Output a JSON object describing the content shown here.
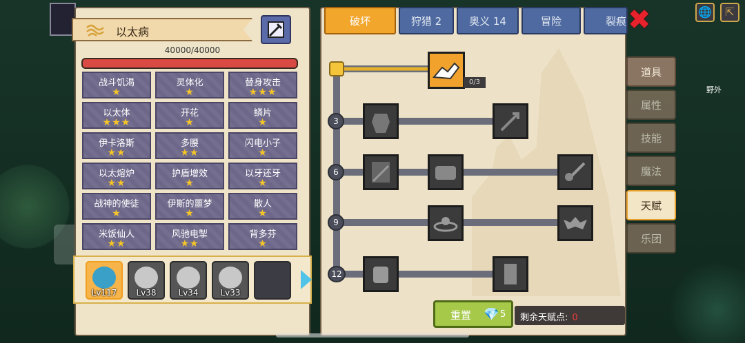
{
  "header": {
    "title": "以太病",
    "hp": "40000/40000",
    "hp_fraction": 1.0
  },
  "traits": [
    {
      "name": "战斗饥渴",
      "stars": 1
    },
    {
      "name": "灵体化",
      "stars": 1
    },
    {
      "name": "替身攻击",
      "stars": 3
    },
    {
      "name": "以太体",
      "stars": 3
    },
    {
      "name": "开花",
      "stars": 1
    },
    {
      "name": "鳞片",
      "stars": 1
    },
    {
      "name": "伊卡洛斯",
      "stars": 2
    },
    {
      "name": "多腰",
      "stars": 2
    },
    {
      "name": "闪电小子",
      "stars": 1
    },
    {
      "name": "以太熔炉",
      "stars": 2
    },
    {
      "name": "护盾增效",
      "stars": 1
    },
    {
      "name": "以牙还牙",
      "stars": 1
    },
    {
      "name": "战神的使徒",
      "stars": 1
    },
    {
      "name": "伊斯的噩梦",
      "stars": 1
    },
    {
      "name": "散人",
      "stars": 1
    },
    {
      "name": "米饭仙人",
      "stars": 2
    },
    {
      "name": "风驰电掣",
      "stars": 2
    },
    {
      "name": "背多芬",
      "stars": 1
    }
  ],
  "team": [
    {
      "level": "Lv117",
      "selected": true
    },
    {
      "level": "Lv38",
      "selected": false
    },
    {
      "level": "Lv34",
      "selected": false
    },
    {
      "level": "Lv33",
      "selected": false
    },
    {
      "level": "",
      "selected": false
    }
  ],
  "tabs": [
    "破坏",
    "狩猎 2",
    "奥义 14",
    "冒险",
    "裂痕"
  ],
  "active_tab": 0,
  "tree": {
    "top_node_progress": "0/3",
    "levels": [
      "3",
      "6",
      "9",
      "12"
    ]
  },
  "side_tabs": [
    "道具",
    "属性",
    "技能",
    "魔法",
    "天赋",
    "乐团"
  ],
  "active_side_tab": 4,
  "reset": {
    "label": "重置",
    "cost": "5"
  },
  "points": {
    "label": "剩余天赋点:",
    "value": "0"
  },
  "map_label": "野外"
}
